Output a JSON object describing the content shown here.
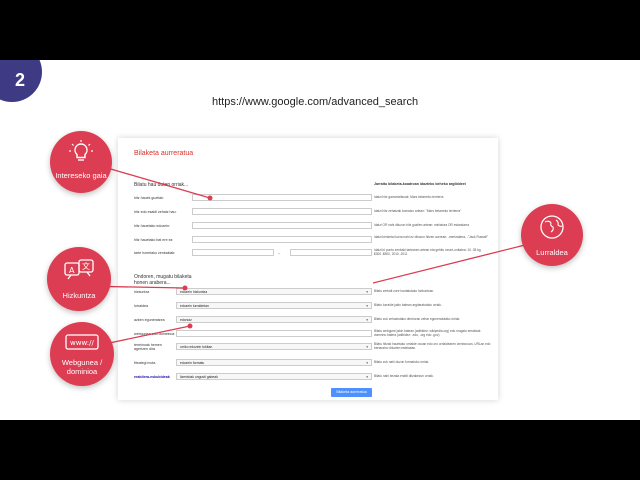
{
  "step_number": "2",
  "url": "https://www.google.com/advanced_search",
  "bubbles": {
    "interest": "Intereseko gaia",
    "language": "Hizkuntza",
    "website": "Webgunea / dominioa",
    "region": "Lurraldea"
  },
  "form": {
    "title": "Bilaketa aurreratua",
    "section1": "Bilatu hau duten orriak...",
    "section1_hint": "Jarraitu bilaketa-koadroan idazteko beheko argibideei",
    "rows1": [
      {
        "label": "hitz hauek guztiak:",
        "hint": "Idatzi hitz garrantzitsuak: Mars belarreko terrierra"
      },
      {
        "label": "hitz edo esaldi zehatz hau:",
        "hint": "Idatzi hitz zehatzak komatxo artean: \"Mars belarreko terrierra\""
      },
      {
        "label": "hitz hauetako edozein:",
        "hint": "Idatzi OR nahi dituzun hitz guztien artean: miniatura OR estandarra"
      },
      {
        "label": "hitz hauetako bat ere ez:",
        "hint": "Idatzi kenketa ikurra nahi ez dituzun hitzen aurrean: -mertzalarra, -\"Jack Russell\""
      },
      {
        "label": "tarte honetako zenbakiak:",
        "hint": "Idatzi bi puntu zenbaki tartearen artean eta gehitu neurri-unitatea: 10..35 kg, $300..$500, 2010..2011"
      }
    ],
    "section2": "Ondoren, mugatu bilaketa honen arabera...",
    "rows2": [
      {
        "label": "hizkuntza",
        "value": "edozein hizkuntza",
        "hint": "Bilatu zerbait zure hautatutako hizkuntzan."
      },
      {
        "label": "lurraldea",
        "value": "edozein lurraldetan",
        "hint": "Bilatu lurralde jakin batean argitaratutako orriak."
      },
      {
        "label": "azken eguneratzea",
        "value": "edonoiz",
        "hint": "Bilatu zuk zehaztutako denboran zehar eguneratutako orriak."
      },
      {
        "label": "webgunea edo domeinua",
        "value": "",
        "hint": "Bilatu webgune jakin batean (adibidez: wikipedia.org) edo mugatu emaitzak domeinu batera (adibidez: .edu, .org edo .gov)."
      },
      {
        "label": "terminoak hemen agertzen dira",
        "value": "orriko edozein tokitan",
        "hint": "Bilatu hitzak hauetako orrialde osoan edo oro orrialdearen izenburuan, URLan edo bertaraino dituzten estekatan."
      },
      {
        "label": "fitxategi mota",
        "value": "edozein formatu",
        "hint": "Bilatu zuk nahi duzun formatuko orriak."
      },
      {
        "label": "erabilera-eskubideak",
        "value": "lizentziak ongusti gabeak",
        "hint": "Bilatu nahi bezala erabil ditzakezun orriak."
      }
    ],
    "submit": "Bilaketa aurreratua"
  },
  "colors": {
    "accent": "#dc3d52",
    "badge": "#3f3a84"
  }
}
